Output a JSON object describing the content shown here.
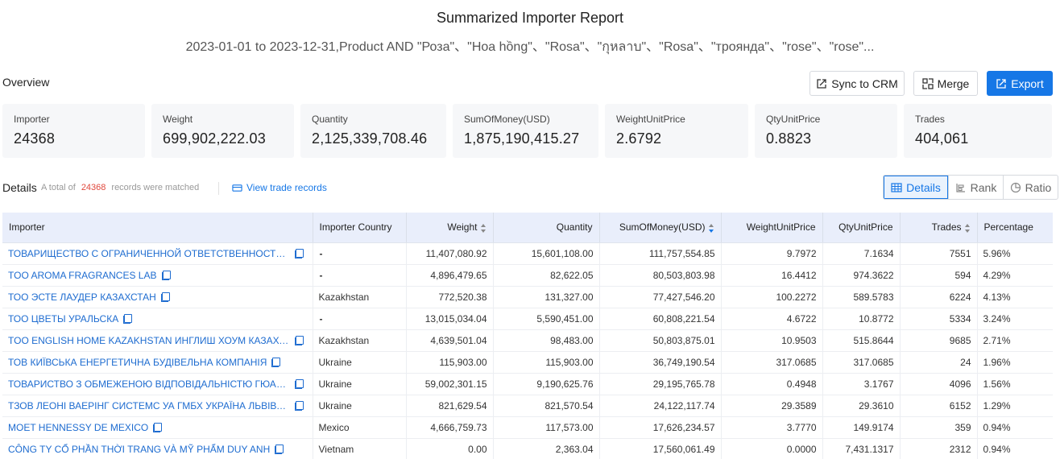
{
  "header": {
    "title": "Summarized Importer Report",
    "subtitle": "2023-01-01 to 2023-12-31,Product AND \"Роза\"、\"Hoa hồng\"、\"Rosa\"、\"กุหลาบ\"、\"Rosa\"、\"троянда\"、\"rose\"、\"rose\"..."
  },
  "overview": {
    "label": "Overview",
    "buttons": {
      "sync": "Sync to CRM",
      "merge": "Merge",
      "export": "Export"
    },
    "stats": [
      {
        "label": "Importer",
        "value": "24368"
      },
      {
        "label": "Weight",
        "value": "699,902,222.03"
      },
      {
        "label": "Quantity",
        "value": "2,125,339,708.46"
      },
      {
        "label": "SumOfMoney(USD)",
        "value": "1,875,190,415.27"
      },
      {
        "label": "WeightUnitPrice",
        "value": "2.6792"
      },
      {
        "label": "QtyUnitPrice",
        "value": "0.8823"
      },
      {
        "label": "Trades",
        "value": "404,061"
      }
    ]
  },
  "details": {
    "label": "Details",
    "count_prefix": "A total of",
    "count": "24368",
    "count_suffix": "records were matched",
    "view_link": "View trade records",
    "tabs": [
      "Details",
      "Rank",
      "Ratio"
    ],
    "active_tab": "Details"
  },
  "table": {
    "columns": [
      "Importer",
      "Importer Country",
      "Weight",
      "Quantity",
      "SumOfMoney(USD)",
      "WeightUnitPrice",
      "QtyUnitPrice",
      "Trades",
      "Percentage"
    ],
    "rows": [
      {
        "importer": "ТОВАРИЩЕСТВО С ОГРАНИЧЕННОЙ ОТВЕТСТВЕННОСТЬЮ IMPO...",
        "country": "-",
        "weight": "11,407,080.92",
        "quantity": "15,601,108.00",
        "sum": "111,757,554.85",
        "wup": "9.7972",
        "qup": "7.1634",
        "trades": "7551",
        "pct": "5.96%"
      },
      {
        "importer": "TOO AROMA FRAGRANCES LAB",
        "country": "-",
        "weight": "4,896,479.65",
        "quantity": "82,622.05",
        "sum": "80,503,803.98",
        "wup": "16.4412",
        "qup": "974.3622",
        "trades": "594",
        "pct": "4.29%"
      },
      {
        "importer": "ТОО ЭСТЕ ЛАУДЕР КАЗАХСТАН",
        "country": "Kazakhstan",
        "weight": "772,520.38",
        "quantity": "131,327.00",
        "sum": "77,427,546.20",
        "wup": "100.2272",
        "qup": "589.5783",
        "trades": "6224",
        "pct": "4.13%"
      },
      {
        "importer": "ТОО ЦВЕТЫ УРАЛЬСКА",
        "country": "-",
        "weight": "13,015,034.04",
        "quantity": "5,590,451.00",
        "sum": "60,808,221.54",
        "wup": "4.6722",
        "qup": "10.8772",
        "trades": "5334",
        "pct": "3.24%"
      },
      {
        "importer": "TOO ENGLISH HOME KAZAKHSTAN ИНГЛИШ ХОУМ КАЗАХСТАН",
        "country": "Kazakhstan",
        "weight": "4,639,501.04",
        "quantity": "98,483.00",
        "sum": "50,803,875.01",
        "wup": "10.9503",
        "qup": "515.8644",
        "trades": "9685",
        "pct": "2.71%"
      },
      {
        "importer": "ТОВ КИЇВСЬКА ЕНЕРГЕТИЧНА БУДІВЕЛЬНА КОМПАНІЯ",
        "country": "Ukraine",
        "weight": "115,903.00",
        "quantity": "115,903.00",
        "sum": "36,749,190.54",
        "wup": "317.0685",
        "qup": "317.0685",
        "trades": "24",
        "pct": "1.96%"
      },
      {
        "importer": "ТОВАРИСТВО З ОБМЕЖЕНОЮ ВІДПОВІДАЛЬНІСТЮ ГЮАЛОС",
        "country": "Ukraine",
        "weight": "59,002,301.15",
        "quantity": "9,190,625.76",
        "sum": "29,195,765.78",
        "wup": "0.4948",
        "qup": "3.1767",
        "trades": "4096",
        "pct": "1.56%"
      },
      {
        "importer": "ТЗОВ ЛЕОНІ ВАЕРІНГ СИСТЕМС УА ГМБХ УКРАЇНА ЛЬВІВСЬКА О...",
        "country": "Ukraine",
        "weight": "821,629.54",
        "quantity": "821,570.54",
        "sum": "24,122,117.74",
        "wup": "29.3589",
        "qup": "29.3610",
        "trades": "6152",
        "pct": "1.29%"
      },
      {
        "importer": "MOET HENNESSY DE MEXICO",
        "country": "Mexico",
        "weight": "4,666,759.73",
        "quantity": "117,573.00",
        "sum": "17,626,234.57",
        "wup": "3.7770",
        "qup": "149.9174",
        "trades": "359",
        "pct": "0.94%"
      },
      {
        "importer": "CÔNG TY CỔ PHẦN THỜI TRANG VÀ MỸ PHẨM DUY ANH",
        "country": "Vietnam",
        "weight": "0.00",
        "quantity": "2,363.04",
        "sum": "17,560,061.49",
        "wup": "0.0000",
        "qup": "7,431.1317",
        "trades": "2312",
        "pct": "0.94%"
      }
    ]
  }
}
